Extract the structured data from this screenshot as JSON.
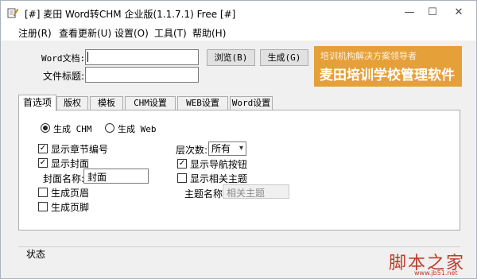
{
  "window": {
    "title": "[#] 麦田 Word转CHM 企业版(1.1.7.1) Free [#]",
    "minimize_glyph": "—",
    "maximize_glyph": "☐",
    "close_glyph": "✕"
  },
  "menu": [
    "注册(R)",
    "查看更新(U)",
    "设置(O)",
    "工具(T)",
    "帮助(H)"
  ],
  "form": {
    "word_doc_label": "Word文档:",
    "word_doc_value": "",
    "file_title_label": "文件标题:",
    "file_title_value": "",
    "browse_label": "浏览(B)",
    "generate_label": "生成(G)"
  },
  "banner": {
    "line1": "培训机构解决方案领导者",
    "line2": "麦田培训学校管理软件",
    "bg_color": "#e5a03a"
  },
  "tabs": [
    "首选项",
    "版权",
    "模板",
    "CHM设置",
    "WEB设置",
    "Word设置"
  ],
  "active_tab": "首选项",
  "options": {
    "radio_chm": "生成 CHM",
    "radio_web": "生成 Web",
    "radio_selected": "chm",
    "show_chapter_numbers": {
      "label": "显示章节编号",
      "checked": true
    },
    "show_cover": {
      "label": "显示封面",
      "checked": true
    },
    "cover_name_label": "封面名称:",
    "cover_name_value": "封面",
    "gen_header": {
      "label": "生成页眉",
      "checked": false
    },
    "gen_footer": {
      "label": "生成页脚",
      "checked": false
    },
    "levels_label": "层次数:",
    "levels_value": "所有",
    "show_nav_buttons": {
      "label": "显示导航按钮",
      "checked": true
    },
    "show_related_topics": {
      "label": "显示相关主题",
      "checked": false
    },
    "topic_name_label": "主题名称:",
    "topic_name_placeholder": "相关主题"
  },
  "status": {
    "label": "状态"
  },
  "watermark": {
    "text": "脚本之家",
    "url": "www.jb51.net"
  }
}
